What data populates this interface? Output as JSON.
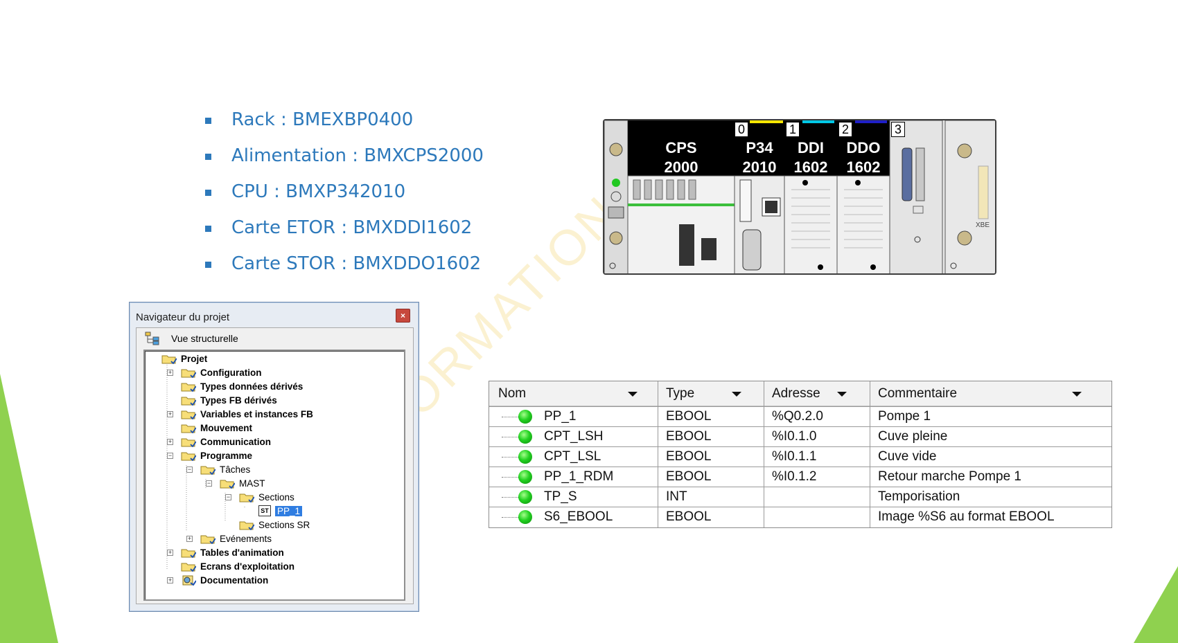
{
  "colors": {
    "bullet_text": "#2d79bb",
    "accent_green": "#8fd14f",
    "selection": "#2f7de1",
    "status_green": "#22d220"
  },
  "watermark": "ORMATION",
  "bullets": [
    "Rack : BMEXBP0400",
    "Alimentation : BMXCPS2000",
    "CPU : BMXP342010",
    "Carte ETOR : BMXDDI1602",
    "Carte STOR : BMXDDO1602"
  ],
  "rack": {
    "ps_label": [
      "CPS",
      "2000"
    ],
    "cpu_label": [
      "P34",
      "2010"
    ],
    "ddi_label": [
      "DDI",
      "1602"
    ],
    "ddo_label": [
      "DDO",
      "1602"
    ],
    "slots": [
      "0",
      "1",
      "2",
      "3"
    ],
    "side_label": "XBE"
  },
  "navigator": {
    "title": "Navigateur du projet",
    "close": "×",
    "view_label": "Vue structurelle",
    "tree": [
      {
        "label": "Projet",
        "bold": true
      },
      {
        "label": "Configuration",
        "bold": true
      },
      {
        "label": "Types données dérivés",
        "bold": true
      },
      {
        "label": "Types FB dérivés",
        "bold": true
      },
      {
        "label": "Variables et instances FB",
        "bold": true
      },
      {
        "label": "Mouvement",
        "bold": true
      },
      {
        "label": "Communication",
        "bold": true
      },
      {
        "label": "Programme",
        "bold": true
      },
      {
        "label": "Tâches",
        "bold": false
      },
      {
        "label": "MAST",
        "bold": false
      },
      {
        "label": "Sections",
        "bold": false
      },
      {
        "label": "PP_1",
        "bold": false,
        "icon_text": "ST"
      },
      {
        "label": "Sections SR",
        "bold": false
      },
      {
        "label": "Evénements",
        "bold": false
      },
      {
        "label": "Tables d'animation",
        "bold": true
      },
      {
        "label": "Ecrans d'exploitation",
        "bold": true
      },
      {
        "label": "Documentation",
        "bold": true
      }
    ]
  },
  "variables_table": {
    "headers": [
      "Nom",
      "Type",
      "Adresse",
      "Commentaire"
    ],
    "rows": [
      {
        "nom": "PP_1",
        "type": "EBOOL",
        "adresse": "%Q0.2.0",
        "commentaire": "Pompe 1"
      },
      {
        "nom": "CPT_LSH",
        "type": "EBOOL",
        "adresse": "%I0.1.0",
        "commentaire": "Cuve pleine"
      },
      {
        "nom": "CPT_LSL",
        "type": "EBOOL",
        "adresse": "%I0.1.1",
        "commentaire": "Cuve vide"
      },
      {
        "nom": "PP_1_RDM",
        "type": "EBOOL",
        "adresse": "%I0.1.2",
        "commentaire": "Retour marche Pompe 1"
      },
      {
        "nom": "TP_S",
        "type": "INT",
        "adresse": "",
        "commentaire": "Temporisation"
      },
      {
        "nom": "S6_EBOOL",
        "type": "EBOOL",
        "adresse": "",
        "commentaire": "Image %S6 au format EBOOL"
      }
    ]
  }
}
